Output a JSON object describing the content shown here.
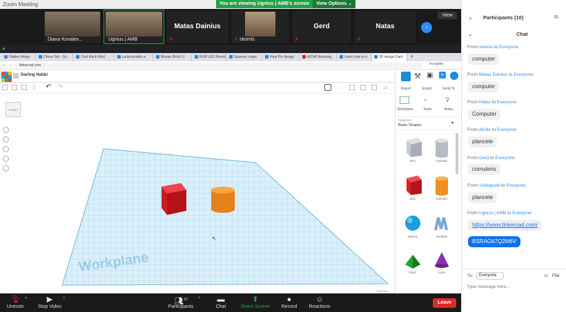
{
  "window": {
    "title": "Zoom Meeting"
  },
  "banner": {
    "viewing": "You are viewing Ugnius | AMB's screen",
    "view_options": "View Options ⌄"
  },
  "gallery": {
    "tiles": [
      "Diana Kovalev...",
      "Ugnius | AMB",
      "Matas Dainius",
      "skomis",
      "Gerd",
      "Natas"
    ],
    "view_label": "View"
  },
  "browser": {
    "tabs": [
      "Hidden things",
      "Chess Set - Gu",
      "Cool Rack Hold",
      "customizable w",
      "Mosaic Brick Lt",
      "RGB LED Remot",
      "Spanner organ",
      "Heat Pin design",
      "WOW! Amazing",
      "Learn how to u",
      "3D design Darti"
    ],
    "url": "tinkercad.com",
    "profile": "Incognito"
  },
  "tinkercad": {
    "design_title": "Darling Habbi",
    "import": "Import",
    "export": "Export",
    "send_to": "Send To",
    "workplane": "Workplane",
    "ruler": "Ruler",
    "notes": "Notes",
    "featured": "Featured",
    "basic_shapes": "Basic Shapes",
    "shapes": [
      "Box",
      "Cylinder",
      "Box",
      "Cylinder",
      "Sphere",
      "Scribble",
      "Roof",
      "Cone"
    ],
    "workplane_text": "Workplane",
    "edit_grid": "Edit Grid",
    "viewcube": "FRONT"
  },
  "toolbar": {
    "unmute": "Unmute",
    "stop_video": "Stop Video",
    "participants": "Participants",
    "participants_count": "10",
    "chat": "Chat",
    "share_screen": "Share Screen",
    "record": "Record",
    "reactions": "Reactions",
    "leave": "Leave"
  },
  "sidebar": {
    "participants_header": "Participants (10)",
    "chat_header": "Chat",
    "messages": [
      {
        "from": "skomis",
        "to": "Everyone",
        "text": "computer"
      },
      {
        "from": "Matas Dainius",
        "to": "Everyone",
        "text": "computer"
      },
      {
        "from": "Natas",
        "to": "Everyone",
        "text": "Computer"
      },
      {
        "from": "Akvile",
        "to": "Everyone",
        "text": "plancete"
      },
      {
        "from": "Gerd",
        "to": "Everyone",
        "text": "comuteris"
      },
      {
        "from": "Sniieguolė",
        "to": "Everyone",
        "text": "plancete"
      },
      {
        "from": "Ugnius | AMB",
        "to": "Everyone",
        "text": "https://www.tinkercad.com/",
        "text2": "BSRAG67Q2M6V"
      }
    ],
    "to_label": "To:",
    "to_value": "Everyone",
    "file": "File",
    "input_placeholder": "Type message here..."
  },
  "colors": {
    "zoom_blue": "#2d8cff",
    "share_green": "#24a148",
    "leave_red": "#e02828",
    "grid": "#9fd4ec"
  }
}
